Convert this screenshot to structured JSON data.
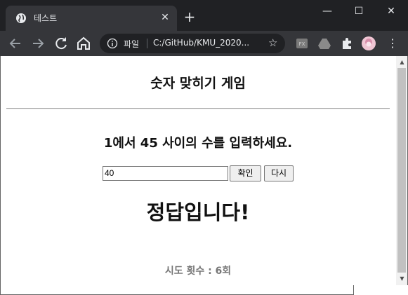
{
  "browser": {
    "tab_title": "테스트",
    "tab_close": "✕",
    "new_tab": "+",
    "window_minimize": "—",
    "window_maximize": "☐",
    "window_close": "✕",
    "omnibox_scheme": "파일",
    "omnibox_url": "C:/GitHub/KMU_2020...",
    "icons": [
      "back-icon",
      "forward-icon",
      "reload-icon",
      "home-icon",
      "info-icon",
      "star-icon",
      "extension-fx-icon",
      "drive-icon",
      "puzzle-icon",
      "profile-avatar",
      "menu-icon"
    ]
  },
  "page": {
    "title": "숫자 맞히기 게임",
    "instruction": "1에서 45 사이의 수를 입력하세요.",
    "input_value": "40",
    "confirm_label": "확인",
    "reset_label": "다시",
    "result": "정답입니다!",
    "tries": "시도 횟수 : 6회"
  },
  "colors": {
    "chrome_dark": "#202124",
    "toolbar": "#35363a",
    "scroll_thumb": "#c1c1c1"
  }
}
